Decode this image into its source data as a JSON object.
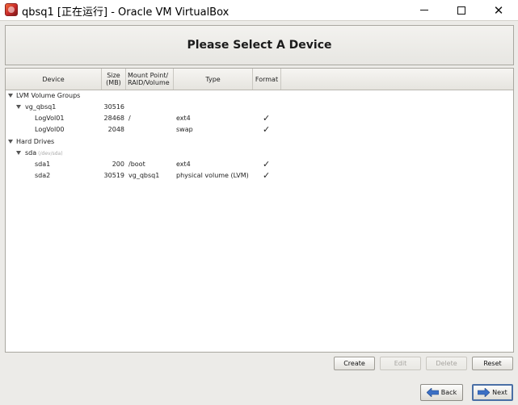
{
  "window": {
    "title": "qbsq1 [正在运行] - Oracle VM VirtualBox",
    "app_icon": "virtualbox-icon",
    "controls": {
      "minimize_icon": "minimize-icon",
      "maximize_icon": "maximize-icon",
      "close_glyph": "✕"
    }
  },
  "installer": {
    "heading": "Please Select A Device",
    "columns": {
      "device": "Device",
      "size_line1": "Size",
      "size_line2": "(MB)",
      "mount_line1": "Mount Point/",
      "mount_line2": "RAID/Volume",
      "type": "Type",
      "format": "Format"
    },
    "rows": [
      {
        "device": "LVM Volume Groups",
        "size": "",
        "mount": "",
        "type": "",
        "format": "",
        "expanded": true
      },
      {
        "device": "vg_qbsq1",
        "size": "30516",
        "mount": "",
        "type": "",
        "format": "",
        "expanded": true
      },
      {
        "device": "LogVol01",
        "size": "28468",
        "mount": "/",
        "type": "ext4",
        "format": "✓"
      },
      {
        "device": "LogVol00",
        "size": "2048",
        "mount": "",
        "type": "swap",
        "format": "✓"
      },
      {
        "device": "Hard Drives",
        "size": "",
        "mount": "",
        "type": "",
        "format": "",
        "expanded": true
      },
      {
        "device": "sda",
        "note": "(/dev/sda)",
        "size": "",
        "mount": "",
        "type": "",
        "format": "",
        "expanded": true
      },
      {
        "device": "sda1",
        "size": "200",
        "mount": "/boot",
        "type": "ext4",
        "format": "✓"
      },
      {
        "device": "sda2",
        "size": "30519",
        "mount": "vg_qbsq1",
        "type": "physical volume (LVM)",
        "format": "✓"
      }
    ],
    "actions": {
      "create": "Create",
      "edit": "Edit",
      "delete": "Delete",
      "reset": "Reset"
    },
    "nav": {
      "back": "Back",
      "next": "Next"
    }
  }
}
